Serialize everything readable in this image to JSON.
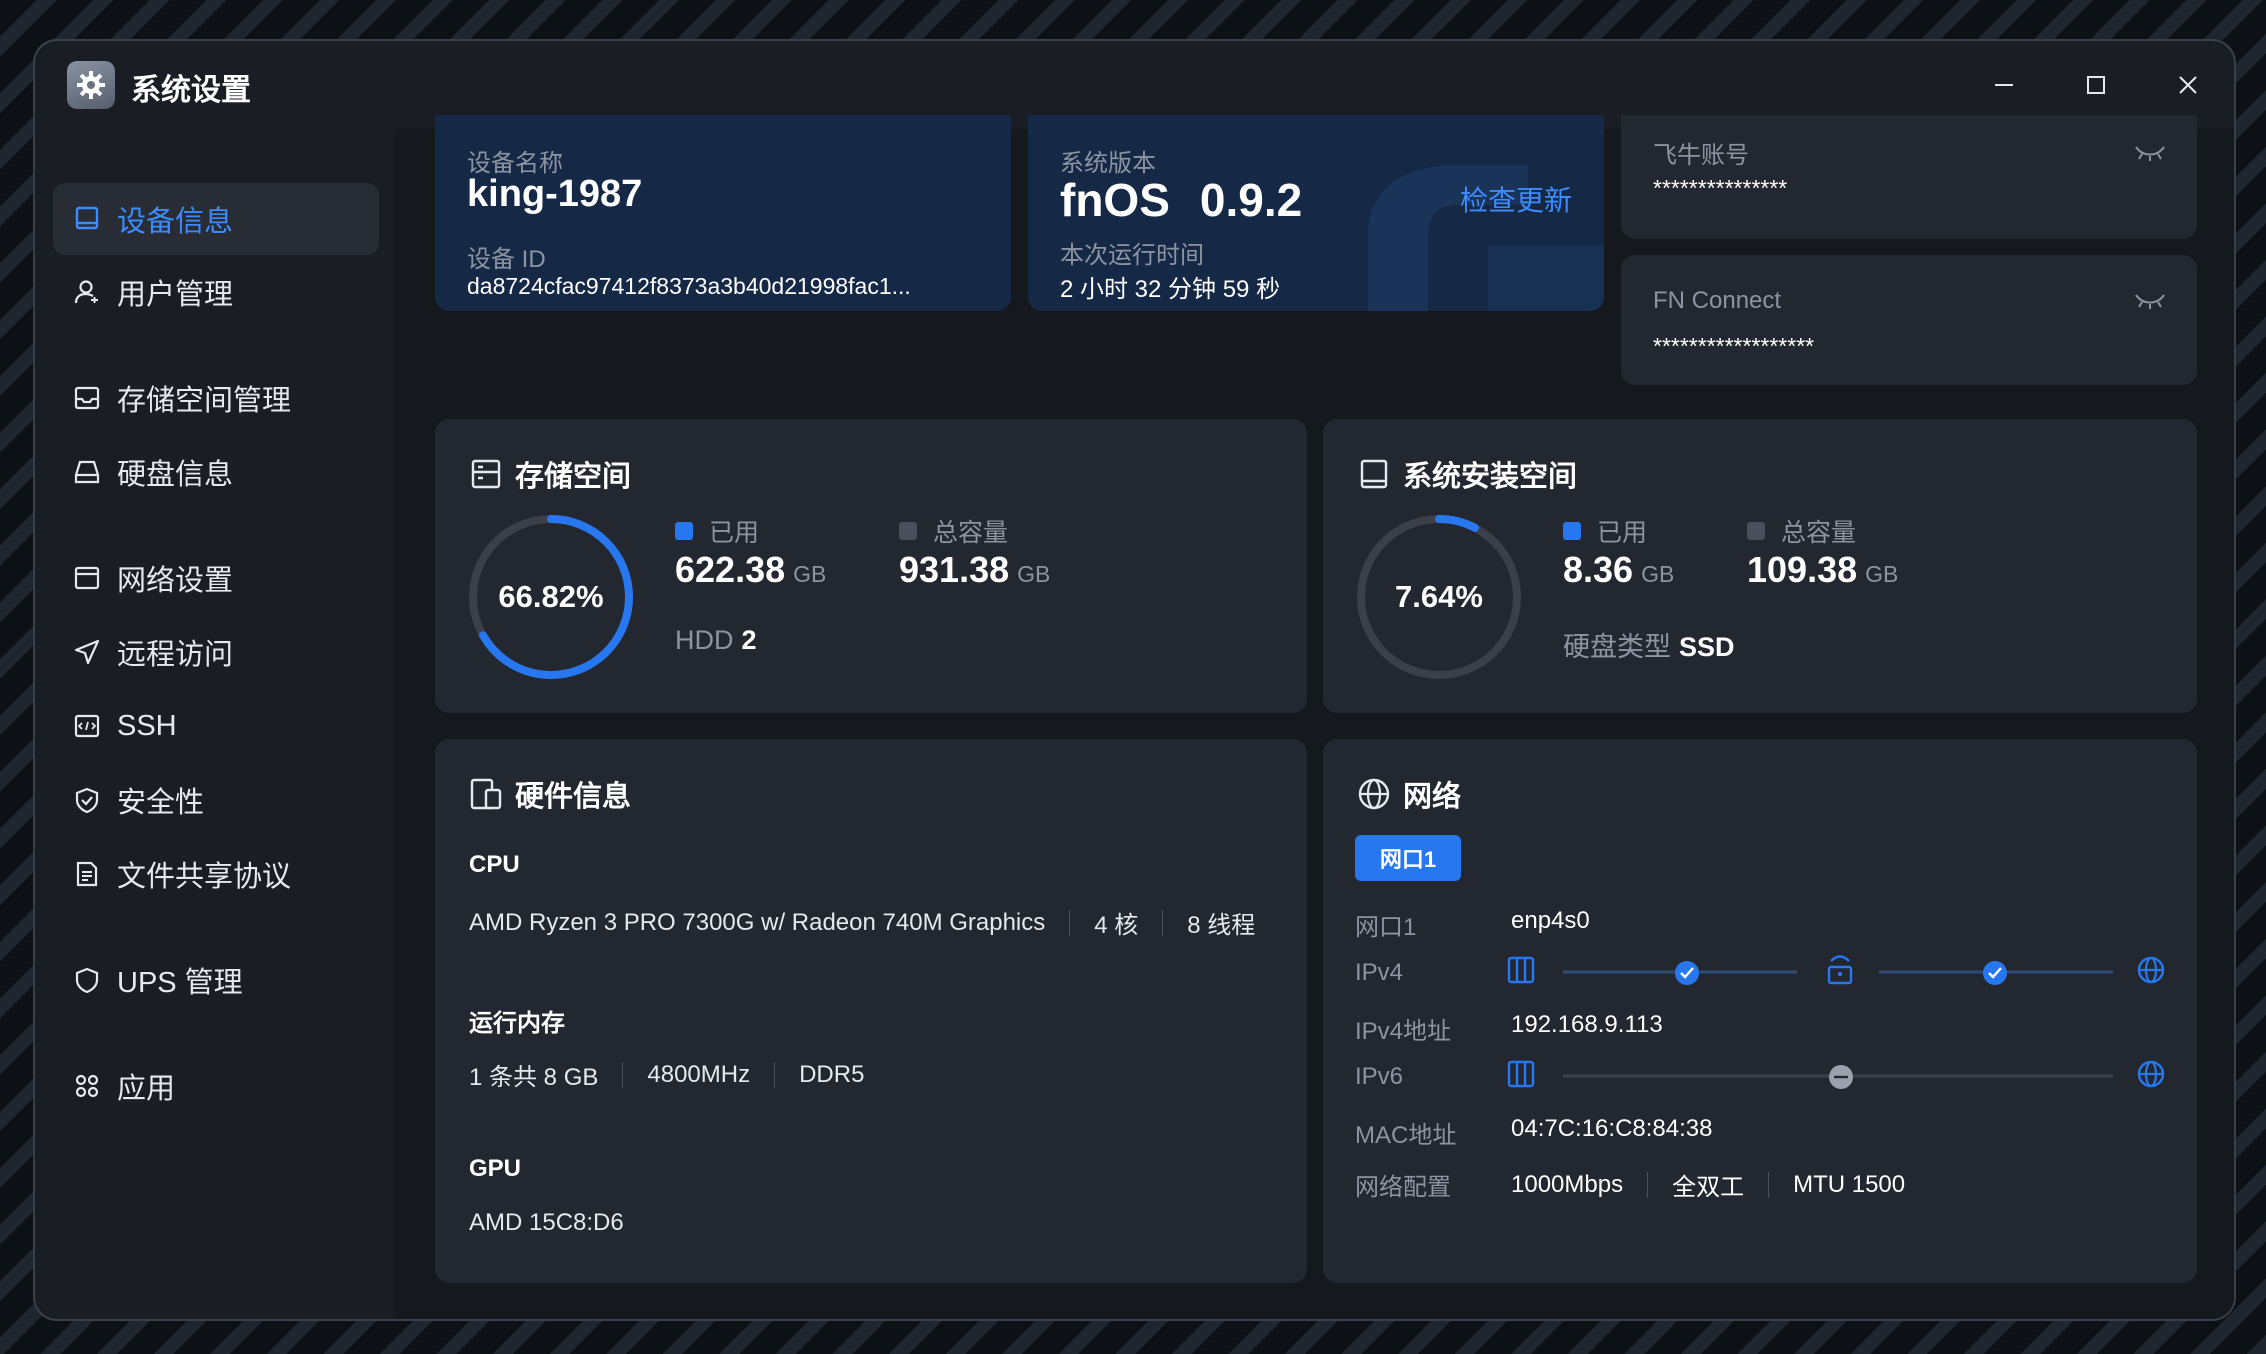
{
  "app": {
    "title": "系统设置"
  },
  "sidebar": {
    "items": [
      {
        "label": "设备信息",
        "icon": "monitor-icon"
      },
      {
        "label": "用户管理",
        "icon": "user-icon"
      },
      {
        "label": "存储空间管理",
        "icon": "storage-icon"
      },
      {
        "label": "硬盘信息",
        "icon": "disk-icon"
      },
      {
        "label": "网络设置",
        "icon": "network-settings-icon"
      },
      {
        "label": "远程访问",
        "icon": "send-icon"
      },
      {
        "label": "SSH",
        "icon": "terminal-icon"
      },
      {
        "label": "安全性",
        "icon": "shield-check-icon"
      },
      {
        "label": "文件共享协议",
        "icon": "document-icon"
      },
      {
        "label": "UPS 管理",
        "icon": "shield-icon"
      },
      {
        "label": "应用",
        "icon": "apps-icon"
      }
    ]
  },
  "device": {
    "name_label": "设备名称",
    "name": "king-1987",
    "id_label": "设备 ID",
    "id": "da8724cfac97412f8373a3b40d21998fac1..."
  },
  "system": {
    "version_label": "系统版本",
    "os": "fnOS",
    "version": "0.9.2",
    "check_update": "检查更新",
    "uptime_label": "本次运行时间",
    "uptime": "2 小时 32 分钟 59 秒"
  },
  "accounts": {
    "feiniu_label": "飞牛账号",
    "feiniu_value": "***************",
    "fnconnect_label": "FN Connect",
    "fnconnect_value": "******************"
  },
  "storage": {
    "title": "存储空间",
    "percent_text": "66.82%",
    "percent": 66.82,
    "used_label": "已用",
    "used": "622.38",
    "total_label": "总容量",
    "total": "931.38",
    "unit": "GB",
    "type_label": "HDD",
    "type_value": "2"
  },
  "install_space": {
    "title": "系统安装空间",
    "percent_text": "7.64%",
    "percent": 7.64,
    "used_label": "已用",
    "used": "8.36",
    "total_label": "总容量",
    "total": "109.38",
    "unit": "GB",
    "type_label": "硬盘类型",
    "type_value": "SSD"
  },
  "hardware": {
    "title": "硬件信息",
    "cpu_label": "CPU",
    "cpu_model": "AMD Ryzen 3 PRO 7300G w/ Radeon 740M Graphics",
    "cpu_cores": "4 核",
    "cpu_threads": "8 线程",
    "mem_label": "运行内存",
    "mem_size": "1 条共 8 GB",
    "mem_speed": "4800MHz",
    "mem_type": "DDR5",
    "gpu_label": "GPU",
    "gpu_model": "AMD 15C8:D6"
  },
  "network": {
    "title": "网络",
    "tab": "网口1",
    "port_label": "网口1",
    "port_value": "enp4s0",
    "ipv4_label": "IPv4",
    "ipv4_addr_label": "IPv4地址",
    "ipv4_addr": "192.168.9.113",
    "ipv6_label": "IPv6",
    "mac_label": "MAC地址",
    "mac": "04:7C:16:C8:84:38",
    "config_label": "网络配置",
    "speed": "1000Mbps",
    "duplex": "全双工",
    "mtu": "MTU 1500"
  },
  "colors": {
    "accent": "#2778f0",
    "link": "#3d8bff",
    "card_bg": "#23272f",
    "card_blue_bg": "#152947",
    "ring_track": "#3a3f49"
  }
}
